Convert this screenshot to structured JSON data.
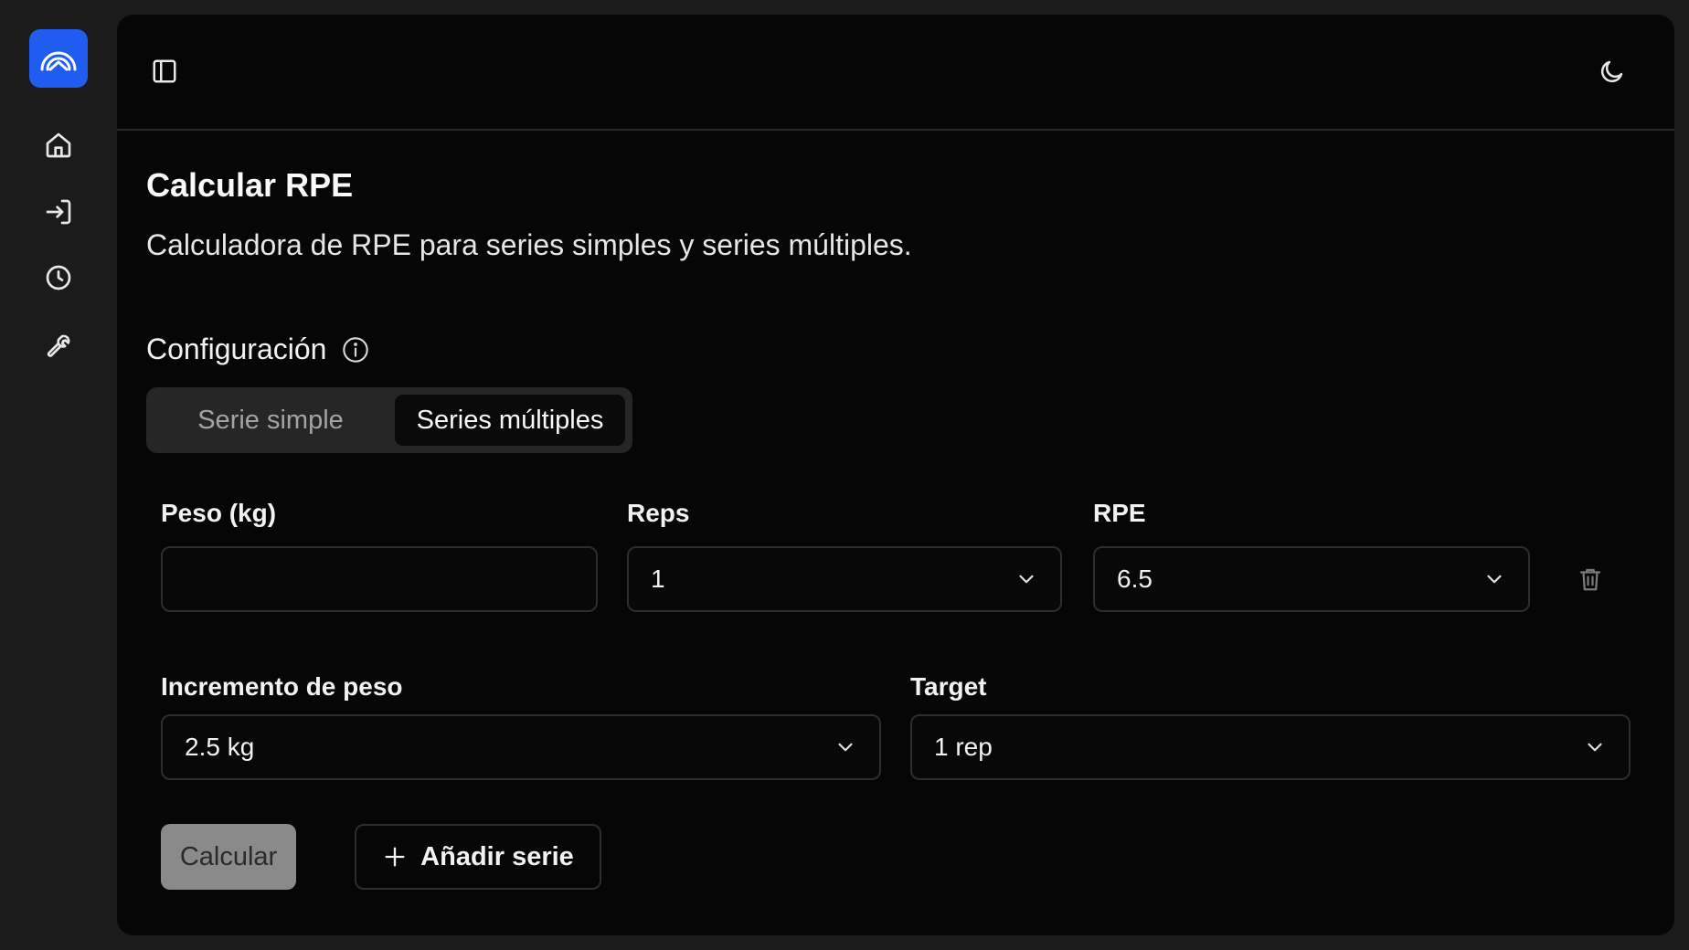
{
  "sidebar": {
    "logo_icon": "logo-icon",
    "brand_color": "#1f5cf0",
    "items": [
      {
        "icon": "home-icon"
      },
      {
        "icon": "login-icon"
      },
      {
        "icon": "clock-icon"
      },
      {
        "icon": "wrench-icon"
      }
    ]
  },
  "topbar": {
    "sidebar_toggle_icon": "sidebar-toggle-icon",
    "theme_icon": "moon-icon"
  },
  "page": {
    "title": "Calcular RPE",
    "subtitle": "Calculadora de RPE para series simples y series múltiples."
  },
  "config": {
    "title": "Configuración",
    "info_icon": "info-icon",
    "tabs": [
      {
        "label": "Serie simple",
        "active": false
      },
      {
        "label": "Series múltiples",
        "active": true
      }
    ]
  },
  "form": {
    "weight_label": "Peso (kg)",
    "weight_value": "",
    "reps_label": "Reps",
    "reps_value": "1",
    "rpe_label": "RPE",
    "rpe_value": "6.5",
    "delete_icon": "trash-icon",
    "increment_label": "Incremento de peso",
    "increment_value": "2.5 kg",
    "target_label": "Target",
    "target_value": "1 rep"
  },
  "actions": {
    "calculate_label": "Calcular",
    "add_series_label": "Añadir serie"
  }
}
